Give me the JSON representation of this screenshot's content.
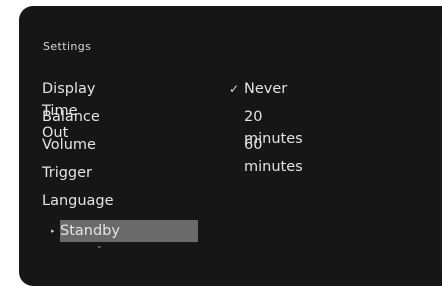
{
  "header": {
    "title": "Settings"
  },
  "menu": {
    "items": [
      {
        "label": "Display Time Out"
      },
      {
        "label": "Balance"
      },
      {
        "label": "Volume"
      },
      {
        "label": "Trigger"
      },
      {
        "label": "Language"
      },
      {
        "label": "Standby",
        "selected": true
      }
    ]
  },
  "options": {
    "items": [
      {
        "label": "Never",
        "checked": true
      },
      {
        "label": "20 minutes"
      },
      {
        "label": "60 minutes"
      }
    ],
    "check_glyph": "✓"
  },
  "icons": {
    "selection_indicator": "caret-right-icon",
    "scroll_down": "chevron-down-icon",
    "check": "check-icon"
  },
  "colors": {
    "background": "#161616",
    "text": "#e4e4e4",
    "highlight": "#6a6a6a"
  }
}
